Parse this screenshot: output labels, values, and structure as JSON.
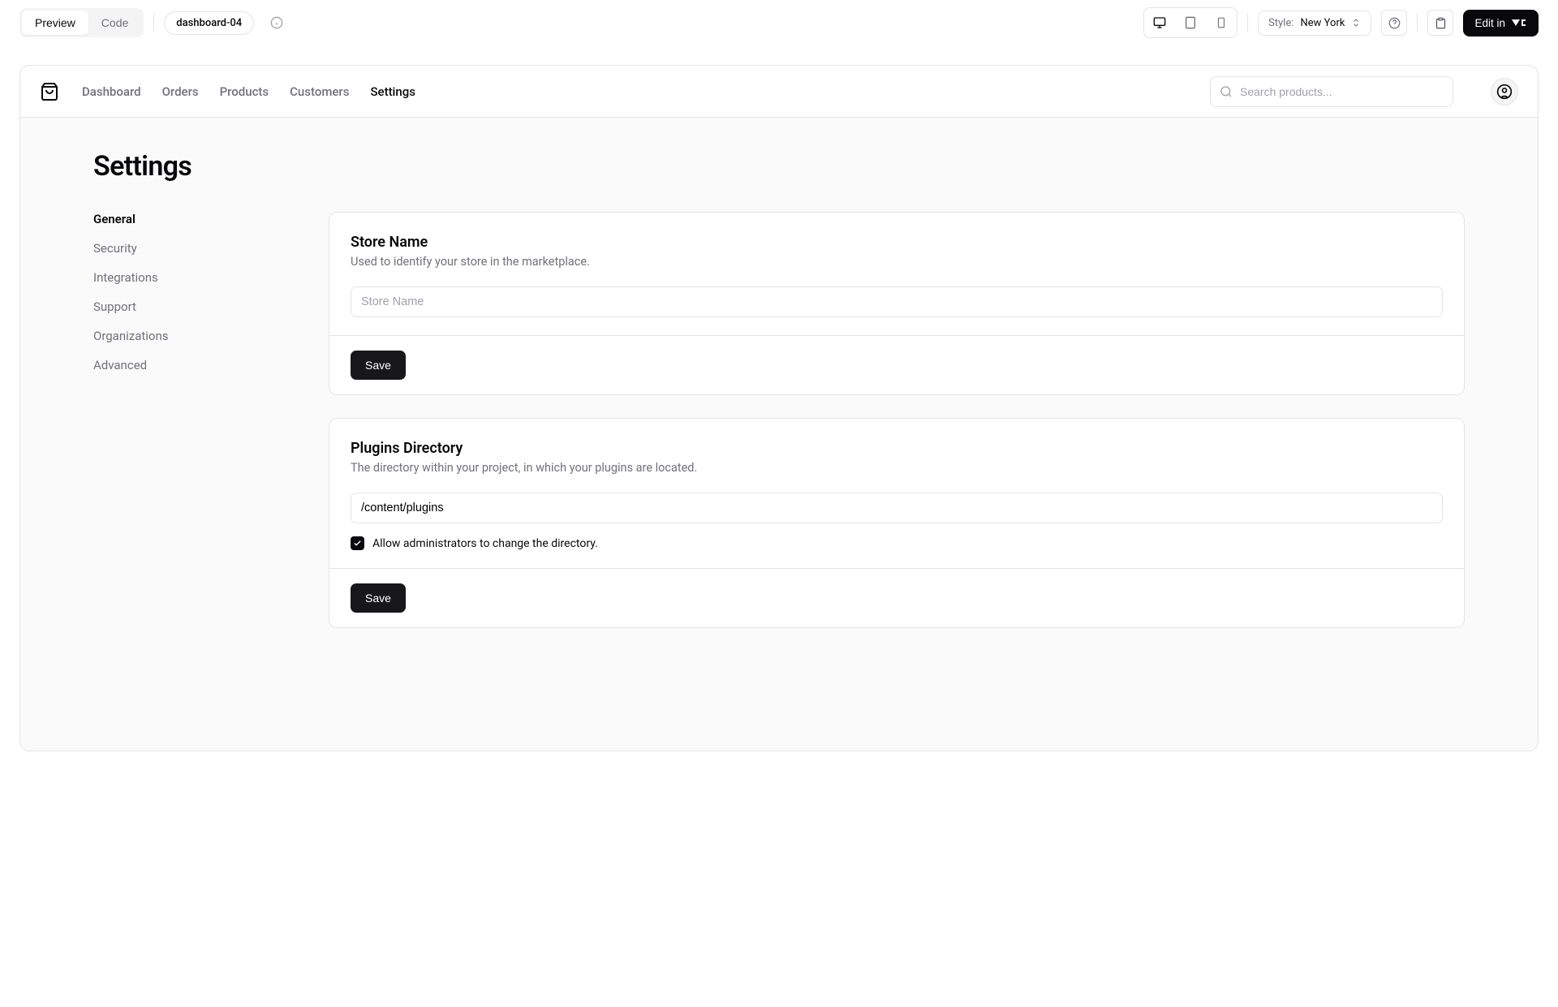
{
  "toolbar": {
    "preview": "Preview",
    "code": "Code",
    "component_name": "dashboard-04",
    "style_label": "Style:",
    "style_value": "New York",
    "edit_in": "Edit in"
  },
  "header": {
    "nav": {
      "dashboard": "Dashboard",
      "orders": "Orders",
      "products": "Products",
      "customers": "Customers",
      "settings": "Settings"
    },
    "search_placeholder": "Search products..."
  },
  "page": {
    "title": "Settings",
    "side_nav": {
      "general": "General",
      "security": "Security",
      "integrations": "Integrations",
      "support": "Support",
      "organizations": "Organizations",
      "advanced": "Advanced"
    },
    "card_store": {
      "title": "Store Name",
      "desc": "Used to identify your store in the marketplace.",
      "placeholder": "Store Name",
      "value": "",
      "save": "Save"
    },
    "card_plugins": {
      "title": "Plugins Directory",
      "desc": "The directory within your project, in which your plugins are located.",
      "value": "/content/plugins",
      "allow_label": "Allow administrators to change the directory.",
      "save": "Save"
    }
  }
}
